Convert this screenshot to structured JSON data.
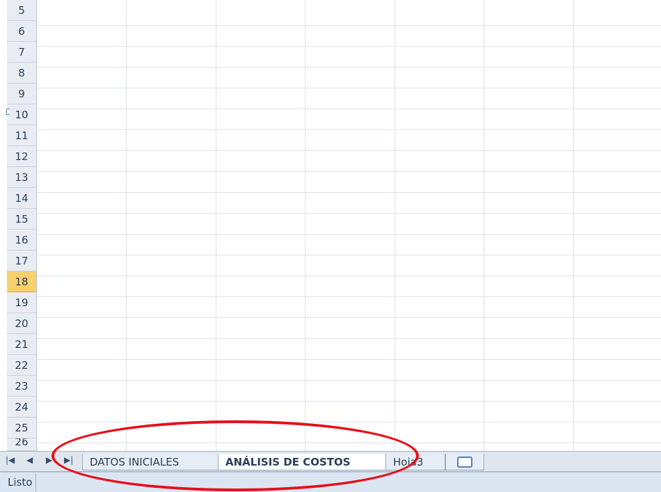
{
  "spreadsheet": {
    "rows": [
      "5",
      "6",
      "7",
      "8",
      "9",
      "10",
      "11",
      "12",
      "13",
      "14",
      "15",
      "16",
      "17",
      "18",
      "19",
      "20",
      "21",
      "22",
      "23",
      "24",
      "25",
      "26"
    ],
    "selected_row": "18"
  },
  "sheet_tabs": {
    "nav_first": "◀",
    "nav_prev": "◀",
    "nav_next": "▶",
    "nav_last": "▶",
    "tabs": [
      {
        "label": "DATOS INICIALES",
        "active": false
      },
      {
        "label": "ANÁLISIS DE COSTOS",
        "active": true
      },
      {
        "label": "Hoja3",
        "active": false
      }
    ],
    "new_sheet_icon": "insert-sheet-icon"
  },
  "status_bar": {
    "label": "Listo"
  },
  "annotation": {
    "color": "#e5101a"
  }
}
